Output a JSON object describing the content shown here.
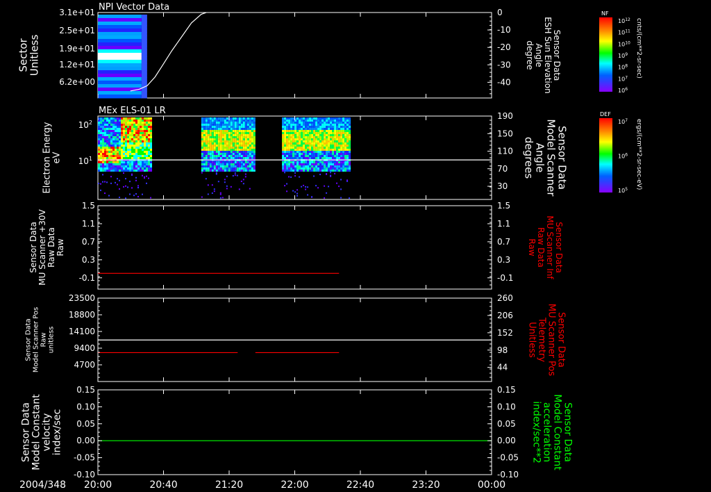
{
  "chart_data": [
    {
      "type": "heatmap",
      "title": "NPI Vector Data",
      "ylabel_left": [
        "Sector",
        "Unitless"
      ],
      "yticks_left": [
        "3.1e+01",
        "2.5e+01",
        "1.9e+01",
        "1.2e+01",
        "6.2e+00"
      ],
      "ylabel_right": [
        "Sensor Data",
        "ESH Sun Elevation",
        "Angle",
        "degree"
      ],
      "yticks_right": [
        "0",
        "-10",
        "-20",
        "-30",
        "-40"
      ],
      "ylim_right": [
        -49,
        0
      ],
      "heatmap_extent_hours": [
        0.0,
        0.5
      ],
      "line_series": {
        "name": "ESH Sun Elevation Angle",
        "color": "#ffffff",
        "x": [
          0.33,
          0.42,
          0.5,
          0.58,
          0.66,
          0.75,
          0.85,
          0.95,
          1.05,
          1.1
        ],
        "y": [
          -45,
          -44,
          -42,
          -37,
          -30,
          -22,
          -14,
          -6,
          -1,
          0
        ]
      },
      "colorbar": {
        "label": "NF",
        "unit": "cnts/(cm**2-sr-sec)",
        "ticks": [
          "10^12",
          "10^11",
          "10^10",
          "10^9",
          "10^8",
          "10^7",
          "10^6"
        ]
      }
    },
    {
      "type": "heatmap",
      "title": "MEx ELS-01 LR",
      "ylabel_left": [
        "Electron Energy",
        "eV"
      ],
      "yticks_left": [
        "10^2",
        "10^1"
      ],
      "ylabel_right": [
        "Sensor Data",
        "Model Scanner",
        "Angle",
        "degrees"
      ],
      "yticks_right": [
        "190",
        "150",
        "110",
        "70",
        "30"
      ],
      "ylim_right": [
        0,
        190
      ],
      "data_segments_hours": [
        [
          0.0,
          0.55
        ],
        [
          1.05,
          1.6
        ],
        [
          1.87,
          2.55
        ]
      ],
      "line_series": {
        "name": "Model Scanner Angle",
        "color": "#ffffff",
        "value": 90
      },
      "colorbar": {
        "label": "DEF",
        "unit": "ergs/(cm**2-sr-sec-eV)",
        "ticks": [
          "10^7",
          "10^6",
          "10^5"
        ]
      }
    },
    {
      "type": "line",
      "ylabel_left": [
        "Sensor Data",
        "MU Scanner +30V",
        "Raw Data",
        "Raw"
      ],
      "yticks_left": [
        "1.5",
        "1.1",
        "0.7",
        "0.3",
        "-0.1"
      ],
      "ylim_left": [
        -0.35,
        1.5
      ],
      "ylabel_right": [
        "Sensor Data",
        "MU Scanner Inf",
        "Raw Data",
        "Raw"
      ],
      "yticks_right": [
        "1.5",
        "1.1",
        "0.7",
        "0.3",
        "-0.1"
      ],
      "ylim_right": [
        -0.35,
        1.5
      ],
      "series": [
        {
          "name": "MU Scanner Inf Raw Data",
          "color": "#ff0000",
          "x": [
            0.0,
            2.45
          ],
          "y": [
            0.0,
            0.0
          ]
        }
      ]
    },
    {
      "type": "line",
      "ylabel_left": [
        "Sensor Data",
        "Model Scanner Pos",
        "Raw",
        "unitless"
      ],
      "yticks_left": [
        "23500",
        "18800",
        "14100",
        "9400",
        "4700"
      ],
      "ylim_left": [
        0,
        23500
      ],
      "ylabel_right": [
        "Sensor Data",
        "MU Scanner Pos",
        "Telemetry",
        "Unitless"
      ],
      "yticks_right": [
        "260",
        "206",
        "152",
        "98",
        "44"
      ],
      "ylim_right": [
        0,
        260
      ],
      "series": [
        {
          "name": "Model Scanner Pos Raw",
          "color": "#ffffff",
          "x": [
            0.0,
            4.0
          ],
          "y": [
            11700,
            11700
          ]
        },
        {
          "name": "MU Scanner Pos Telemetry segment 1",
          "color": "#ff0000",
          "x": [
            0.0,
            1.42
          ],
          "y": [
            90,
            90
          ]
        },
        {
          "name": "MU Scanner Pos Telemetry segment 2",
          "color": "#ff0000",
          "x": [
            1.6,
            2.45
          ],
          "y": [
            90,
            90
          ]
        }
      ]
    },
    {
      "type": "line",
      "ylabel_left": [
        "Sensor Data",
        "Model Constant",
        "velocity",
        "index/sec"
      ],
      "yticks_left": [
        "0.15",
        "0.10",
        "0.05",
        "0.00",
        "-0.05",
        "-0.10"
      ],
      "ylim_left": [
        -0.1,
        0.15
      ],
      "ylabel_right": [
        "Sensor Data",
        "Model Constant",
        "acceleration",
        "index/sec**2"
      ],
      "yticks_right": [
        "0.15",
        "0.10",
        "0.05",
        "0.00",
        "-0.05",
        "-0.10"
      ],
      "ylim_right": [
        -0.1,
        0.15
      ],
      "series": [
        {
          "name": "Model Constant acceleration",
          "color": "#00ff00",
          "x": [
            0.0,
            4.0
          ],
          "y": [
            0.0,
            0.0
          ]
        }
      ]
    }
  ],
  "x_axis": {
    "date": "2004/348",
    "tick_labels": [
      "20:00",
      "20:40",
      "21:20",
      "22:00",
      "22:40",
      "23:20",
      "00:00"
    ],
    "range_hours": [
      0,
      4
    ]
  }
}
